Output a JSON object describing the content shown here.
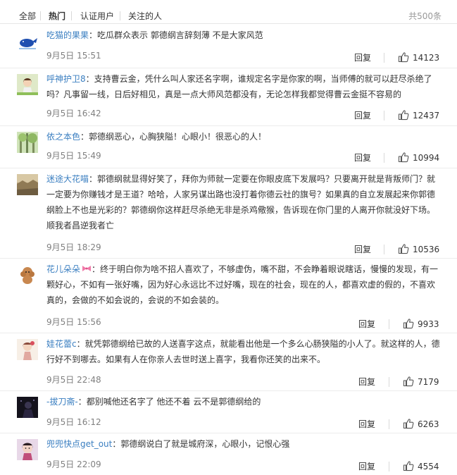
{
  "tabs": [
    "全部",
    "热门",
    "认证用户",
    "关注的人"
  ],
  "total": "共500条",
  "reply_label": "回复",
  "comments": [
    {
      "user": "吃猫的果果",
      "colon": "：",
      "text": "吃瓜群众表示 郭德纲言辞刻薄 不是大家风范",
      "time": "9月5日 15:51",
      "likes": "14123"
    },
    {
      "user": "呼神护卫8",
      "colon": "：",
      "text": "支持曹云金，凭什么叫人家还名字啊，谁规定名字是你家的啊，当师傅的就可以赶尽杀绝了吗？凡事留一线，日后好相见，真是一点大师风范都没有，无论怎样我都觉得曹云金挺不容易的",
      "time": "9月5日 16:42",
      "likes": "12437"
    },
    {
      "user": "依之本色",
      "colon": "：",
      "text": "郭德纲恶心，心胸狭隘！心眼小！很恶心的人！",
      "time": "9月5日 15:49",
      "likes": "10994"
    },
    {
      "user": "迷途大花喵",
      "colon": "：",
      "text": "郭德纲就显得好笑了，拜你为师就一定要在你眼皮底下发展吗？只要离开就是背叛师门？就一定要为你赚钱才是王道？哈哈，人家另谋出路也没打着你德云社的旗号？如果真的自立发展起来你郭德纲脸上不也是光彩的？郭德纲你这样赶尽杀绝无非是杀鸡儆猴，告诉现在你门里的人离开你就没好下场。顺我者昌逆我者亡",
      "time": "9月5日 18:29",
      "likes": "10536"
    },
    {
      "user": "花儿朵朵",
      "colon": "：",
      "text": "终于明白你为啥不招人喜欢了，不够虚伪，嘴不甜，不会睁着眼说瞎话，慢慢的发现，有一颗好心，不如有一张好嘴，因为好心永远比不过好嘴，现在的社会，现在的人，都喜欢虚的假的，不喜欢真的，会做的不如会说的，会说的不如会装的。",
      "time": "9月5日 15:56",
      "likes": "9933"
    },
    {
      "user": "娃花蕾c",
      "colon": "：",
      "text": "就凭郭德纲给已故的人送喜字这点，就能看出他是一个多么心肠狭隘的小人了。就这样的人，德行好不到哪去。如果有人在你亲人去世时送上喜字，我看你还笑的出来不。",
      "time": "9月5日 22:48",
      "likes": "7179"
    },
    {
      "user": "-拔刀斋-",
      "colon": "：",
      "text": "都别喊他还名字了 他还不着 云不是郭德纲给的",
      "time": "9月5日 16:12",
      "likes": "6263"
    },
    {
      "user": "兜兜快点get_out",
      "colon": "：",
      "text": "郭德纲说白了就是城府深，心眼小，记恨心强",
      "time": "9月5日 22:09",
      "likes": "4554"
    }
  ]
}
